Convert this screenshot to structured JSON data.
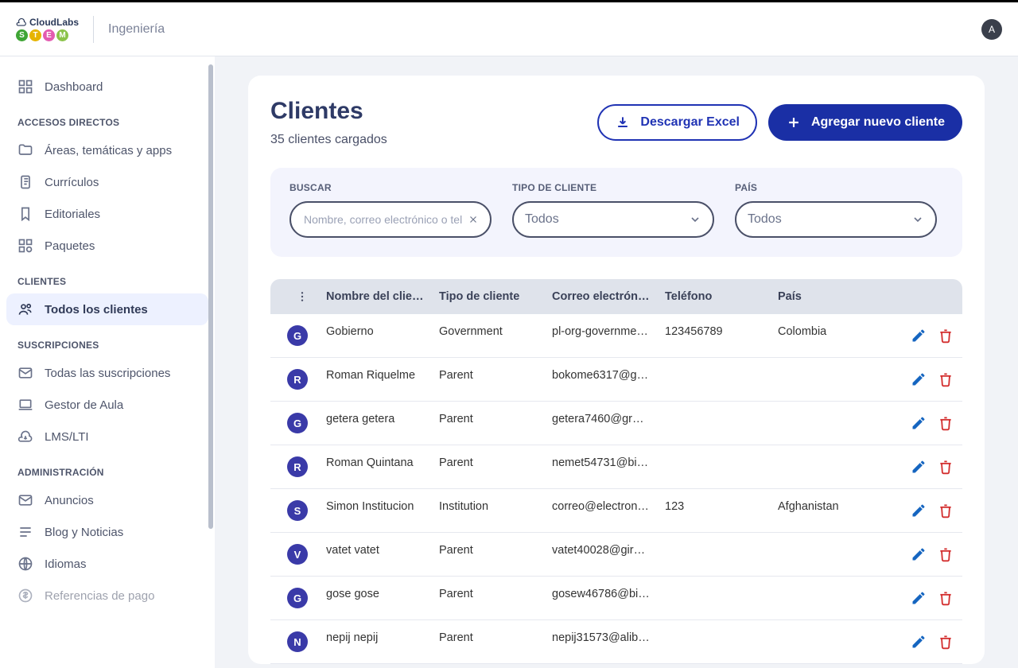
{
  "header": {
    "breadcrumb": "Ingeniería",
    "avatar_initial": "A",
    "logo_text": "CloudLabs",
    "stem": [
      "S",
      "T",
      "E",
      "M"
    ],
    "stem_colors": [
      "#3fa535",
      "#e6b400",
      "#e35bb0",
      "#8bc34a"
    ]
  },
  "sidebar": {
    "top": {
      "dashboard": "Dashboard"
    },
    "sections": [
      {
        "title": "ACCESOS DIRECTOS",
        "items": [
          {
            "label": "Áreas, temáticas y apps",
            "icon": "folder-icon"
          },
          {
            "label": "Currículos",
            "icon": "docs-icon"
          },
          {
            "label": "Editoriales",
            "icon": "bookmark-icon"
          },
          {
            "label": "Paquetes",
            "icon": "package-icon"
          }
        ]
      },
      {
        "title": "CLIENTES",
        "items": [
          {
            "label": "Todos los clientes",
            "icon": "people-icon",
            "active": true
          }
        ]
      },
      {
        "title": "SUSCRIPCIONES",
        "items": [
          {
            "label": "Todas las suscripciones",
            "icon": "mail-icon"
          },
          {
            "label": "Gestor de Aula",
            "icon": "laptop-icon"
          },
          {
            "label": "LMS/LTI",
            "icon": "cloud-down-icon"
          }
        ]
      },
      {
        "title": "ADMINISTRACIÓN",
        "items": [
          {
            "label": "Anuncios",
            "icon": "mail-icon"
          },
          {
            "label": "Blog y Noticias",
            "icon": "bars-icon"
          },
          {
            "label": "Idiomas",
            "icon": "globe-icon"
          },
          {
            "label": "Referencias de pago",
            "icon": "currency-icon"
          }
        ]
      }
    ]
  },
  "page": {
    "title": "Clientes",
    "subtitle": "35 clientes cargados",
    "download_label": "Descargar Excel",
    "add_label": "Agregar nuevo cliente"
  },
  "filters": {
    "search_label": "BUSCAR",
    "search_placeholder": "Nombre, correo electrónico o tel",
    "type_label": "TIPO DE CLIENTE",
    "type_value": "Todos",
    "country_label": "PAÍS",
    "country_value": "Todos"
  },
  "table": {
    "columns": [
      "Nombre del clie…",
      "Tipo de cliente",
      "Correo electrón…",
      "Teléfono",
      "País"
    ],
    "rows": [
      {
        "initial": "G",
        "name": "Gobierno",
        "type": "Government",
        "email": "pl-org-governme…",
        "phone": "123456789",
        "country": "Colombia"
      },
      {
        "initial": "R",
        "name": "Roman Riquelme",
        "type": "Parent",
        "email": "bokome6317@g…",
        "phone": "",
        "country": ""
      },
      {
        "initial": "G",
        "name": "getera getera",
        "type": "Parent",
        "email": "getera7460@gr…",
        "phone": "",
        "country": ""
      },
      {
        "initial": "R",
        "name": "Roman Quintana",
        "type": "Parent",
        "email": "nemet54731@bi…",
        "phone": "",
        "country": ""
      },
      {
        "initial": "S",
        "name": "Simon Institucion",
        "type": "Institution",
        "email": "correo@electron…",
        "phone": "123",
        "country": "Afghanistan"
      },
      {
        "initial": "V",
        "name": "vatet vatet",
        "type": "Parent",
        "email": "vatet40028@gir…",
        "phone": "",
        "country": ""
      },
      {
        "initial": "G",
        "name": "gose gose",
        "type": "Parent",
        "email": "gosew46786@bi…",
        "phone": "",
        "country": ""
      },
      {
        "initial": "N",
        "name": "nepij nepij",
        "type": "Parent",
        "email": "nepij31573@alib…",
        "phone": "",
        "country": ""
      }
    ]
  }
}
